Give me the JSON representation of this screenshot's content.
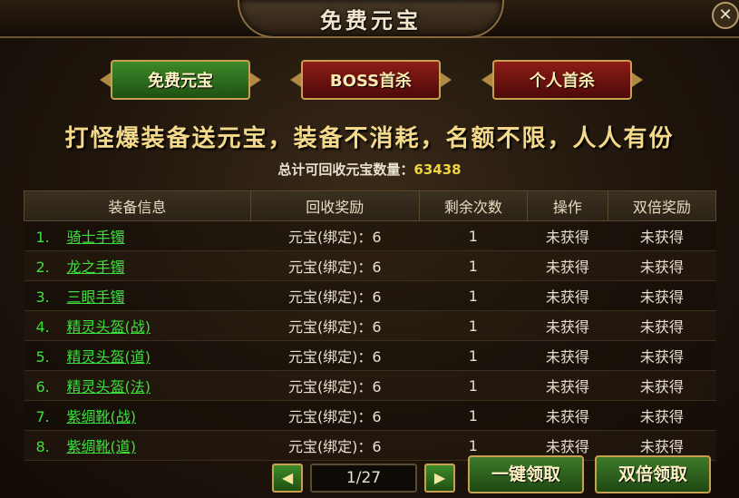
{
  "window": {
    "title": "免费元宝",
    "close_symbol": "✕"
  },
  "tabs": [
    {
      "label": "免费元宝",
      "active": true
    },
    {
      "label": "BOSS首杀",
      "active": false
    },
    {
      "label": "个人首杀",
      "active": false
    }
  ],
  "slogan": "打怪爆装备送元宝，装备不消耗，名额不限，人人有份",
  "total": {
    "label": "总计可回收元宝数量：",
    "value": "63438"
  },
  "table": {
    "headers": [
      "装备信息",
      "回收奖励",
      "剩余次数",
      "操作",
      "双倍奖励"
    ],
    "rows": [
      {
        "index": "1.",
        "item": "骑士手镯",
        "reward": "元宝(绑定)：6",
        "remaining": "1",
        "action": "未获得",
        "double": "未获得"
      },
      {
        "index": "2.",
        "item": "龙之手镯",
        "reward": "元宝(绑定)：6",
        "remaining": "1",
        "action": "未获得",
        "double": "未获得"
      },
      {
        "index": "3.",
        "item": "三眼手镯",
        "reward": "元宝(绑定)：6",
        "remaining": "1",
        "action": "未获得",
        "double": "未获得"
      },
      {
        "index": "4.",
        "item": "精灵头盔(战)",
        "reward": "元宝(绑定)：6",
        "remaining": "1",
        "action": "未获得",
        "double": "未获得"
      },
      {
        "index": "5.",
        "item": "精灵头盔(道)",
        "reward": "元宝(绑定)：6",
        "remaining": "1",
        "action": "未获得",
        "double": "未获得"
      },
      {
        "index": "6.",
        "item": "精灵头盔(法)",
        "reward": "元宝(绑定)：6",
        "remaining": "1",
        "action": "未获得",
        "double": "未获得"
      },
      {
        "index": "7.",
        "item": "紫绸靴(战)",
        "reward": "元宝(绑定)：6",
        "remaining": "1",
        "action": "未获得",
        "double": "未获得"
      },
      {
        "index": "8.",
        "item": "紫绸靴(道)",
        "reward": "元宝(绑定)：6",
        "remaining": "1",
        "action": "未获得",
        "double": "未获得"
      }
    ]
  },
  "pagination": {
    "prev_symbol": "◀",
    "next_symbol": "▶",
    "display": "1/27"
  },
  "buttons": {
    "claim_all": "一键领取",
    "double_claim": "双倍领取"
  },
  "colors": {
    "item_name": "#3de03d",
    "total_value": "#f0d43a",
    "slogan": "#f5d98a"
  }
}
